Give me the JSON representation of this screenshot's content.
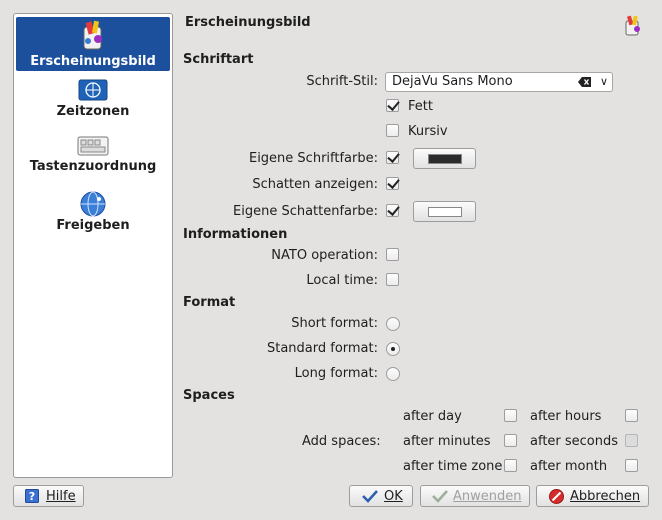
{
  "sidebar": {
    "items": [
      {
        "label": "Erscheinungsbild",
        "icon": "paint-icon",
        "active": true
      },
      {
        "label": "Zeitzonen",
        "icon": "globe-flag-icon"
      },
      {
        "label": "Tastenzuordnung",
        "icon": "keyboard-icon"
      },
      {
        "label": "Freigeben",
        "icon": "network-globe-icon"
      }
    ]
  },
  "page": {
    "title": "Erscheinungsbild"
  },
  "schriftart": {
    "header": "Schriftart",
    "font_label": "Schrift-Stil:",
    "font_value": "DejaVu Sans Mono",
    "bold_label": "Fett",
    "bold_checked": true,
    "italic_label": "Kursiv",
    "italic_checked": false,
    "own_color_label": "Eigene Schriftfarbe:",
    "own_color_checked": true,
    "font_color": "#2b2b2b",
    "shadow_label": "Schatten anzeigen:",
    "shadow_checked": true,
    "shadow_color_label": "Eigene Schattenfarbe:",
    "shadow_color_checked": true,
    "shadow_color": "#ffffff"
  },
  "informationen": {
    "header": "Informationen",
    "nato_label": "NATO operation:",
    "nato_checked": false,
    "local_label": "Local time:",
    "local_checked": false
  },
  "format": {
    "header": "Format",
    "short_label": "Short format:",
    "standard_label": "Standard format:",
    "long_label": "Long format:",
    "selected": "Standard format"
  },
  "spaces": {
    "header": "Spaces",
    "add_label": "Add spaces:",
    "options": [
      {
        "label": "after day",
        "checked": false
      },
      {
        "label": "after hours",
        "checked": false
      },
      {
        "label": "after minutes",
        "checked": false
      },
      {
        "label": "after seconds",
        "checked": false,
        "disabled": true
      },
      {
        "label": "after time zone",
        "checked": false
      },
      {
        "label": "after month",
        "checked": false
      }
    ]
  },
  "buttons": {
    "help": "Hilfe",
    "ok": "OK",
    "apply": "Anwenden",
    "cancel": "Abbrechen"
  }
}
